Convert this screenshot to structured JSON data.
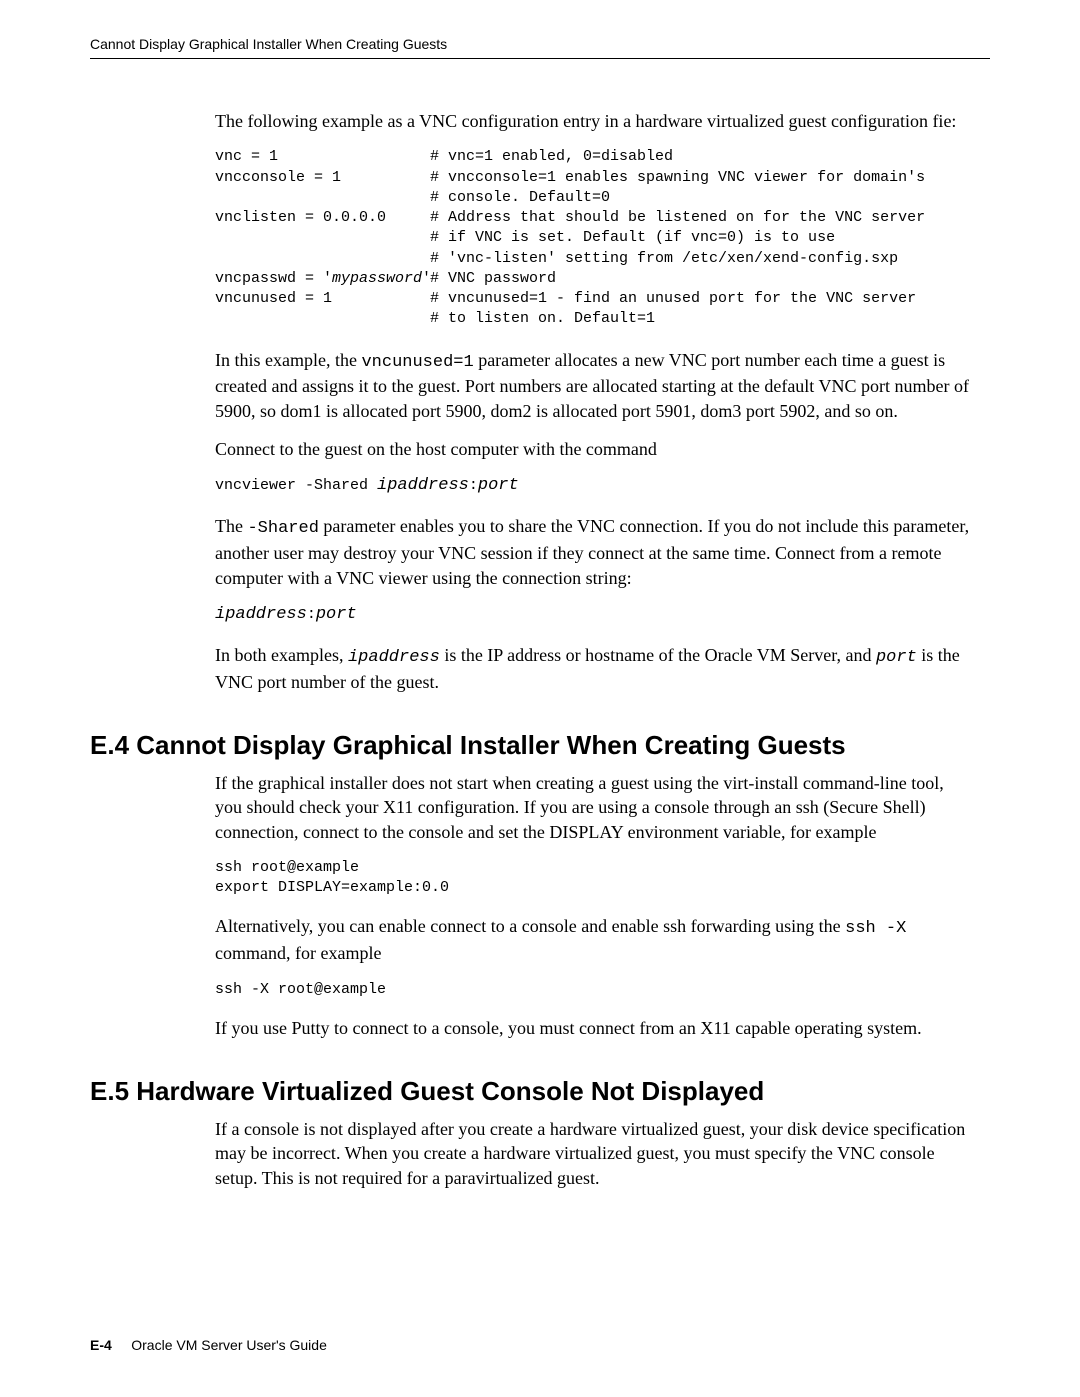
{
  "header": {
    "running": "Cannot Display Graphical Installer When Creating Guests"
  },
  "para": {
    "intro_cfg": "The following example as a VNC configuration entry in a hardware virtualized guest configuration fie:",
    "after_cfg_1a": "In this example, the ",
    "after_cfg_1b": "vncunused=1",
    "after_cfg_1c": " parameter allocates a new VNC port number each time a guest is created and assigns it to the guest. Port numbers are allocated starting at the default VNC port number of 5900, so dom1 is allocated port 5900, dom2 is allocated port 5901, dom3 port 5902, and so on.",
    "connect_host": "Connect to the guest on the host computer with the command",
    "vncviewer_cmd_a": "vncviewer -Shared ",
    "vncviewer_cmd_b": "ipaddress",
    "vncviewer_cmd_c": ":",
    "vncviewer_cmd_d": "port",
    "shared_a": "The ",
    "shared_b": "-Shared",
    "shared_c": " parameter enables you to share the VNC connection. If you do not include this parameter, another user may destroy your VNC session if they connect at the same time. Connect from a remote computer with a VNC viewer using the connection string:",
    "conn_a": "ipaddress",
    "conn_b": ":",
    "conn_c": "port",
    "both_a": "In both examples, ",
    "both_b": "ipaddress",
    "both_c": " is the IP address or hostname of the Oracle VM Server, and ",
    "both_d": "port",
    "both_e": " is the VNC port number of the guest."
  },
  "cfg": [
    {
      "key": "vnc = 1",
      "italic": "",
      "comments": [
        "# vnc=1 enabled, 0=disabled"
      ]
    },
    {
      "key": "vncconsole = 1",
      "italic": "",
      "comments": [
        "# vncconsole=1 enables spawning VNC viewer for domain's",
        "# console. Default=0"
      ]
    },
    {
      "key": "vnclisten = 0.0.0.0",
      "italic": "",
      "comments": [
        "# Address that should be listened on for the VNC server",
        "# if VNC is set. Default (if vnc=0) is to use",
        "# 'vnc-listen' setting from /etc/xen/xend-config.sxp"
      ]
    },
    {
      "key": "vncpasswd = '",
      "italic": "mypassword",
      "tail": "'",
      "comments": [
        "# VNC password"
      ]
    },
    {
      "key": "vncunused = 1",
      "italic": "",
      "comments": [
        "# vncunused=1 - find an unused port for the VNC server",
        "# to listen on. Default=1"
      ]
    }
  ],
  "sec_e4": {
    "title": "E.4  Cannot Display Graphical Installer When Creating Guests",
    "p1": "If the graphical installer does not start when creating a guest using the virt-install command-line tool, you should check your X11 configuration. If you are using a console through an ssh (Secure Shell) connection, connect to the console and set the DISPLAY environment variable, for example",
    "code1": "ssh root@example\nexport DISPLAY=example:0.0",
    "p2a": "Alternatively, you can enable connect to a console and enable ssh forwarding using the ",
    "p2b": "ssh -X",
    "p2c": " command, for example",
    "code2": "ssh -X root@example",
    "p3": "If you use Putty to connect to a console, you must connect from an X11 capable operating system."
  },
  "sec_e5": {
    "title": "E.5  Hardware Virtualized Guest Console Not Displayed",
    "p1": "If a console is not displayed after you create a hardware virtualized guest, your disk device specification may be incorrect. When you create a hardware virtualized guest, you must specify the VNC console setup. This is not required for a paravirtualized guest."
  },
  "footer": {
    "page": "E-4",
    "book": "Oracle VM Server User's Guide"
  }
}
